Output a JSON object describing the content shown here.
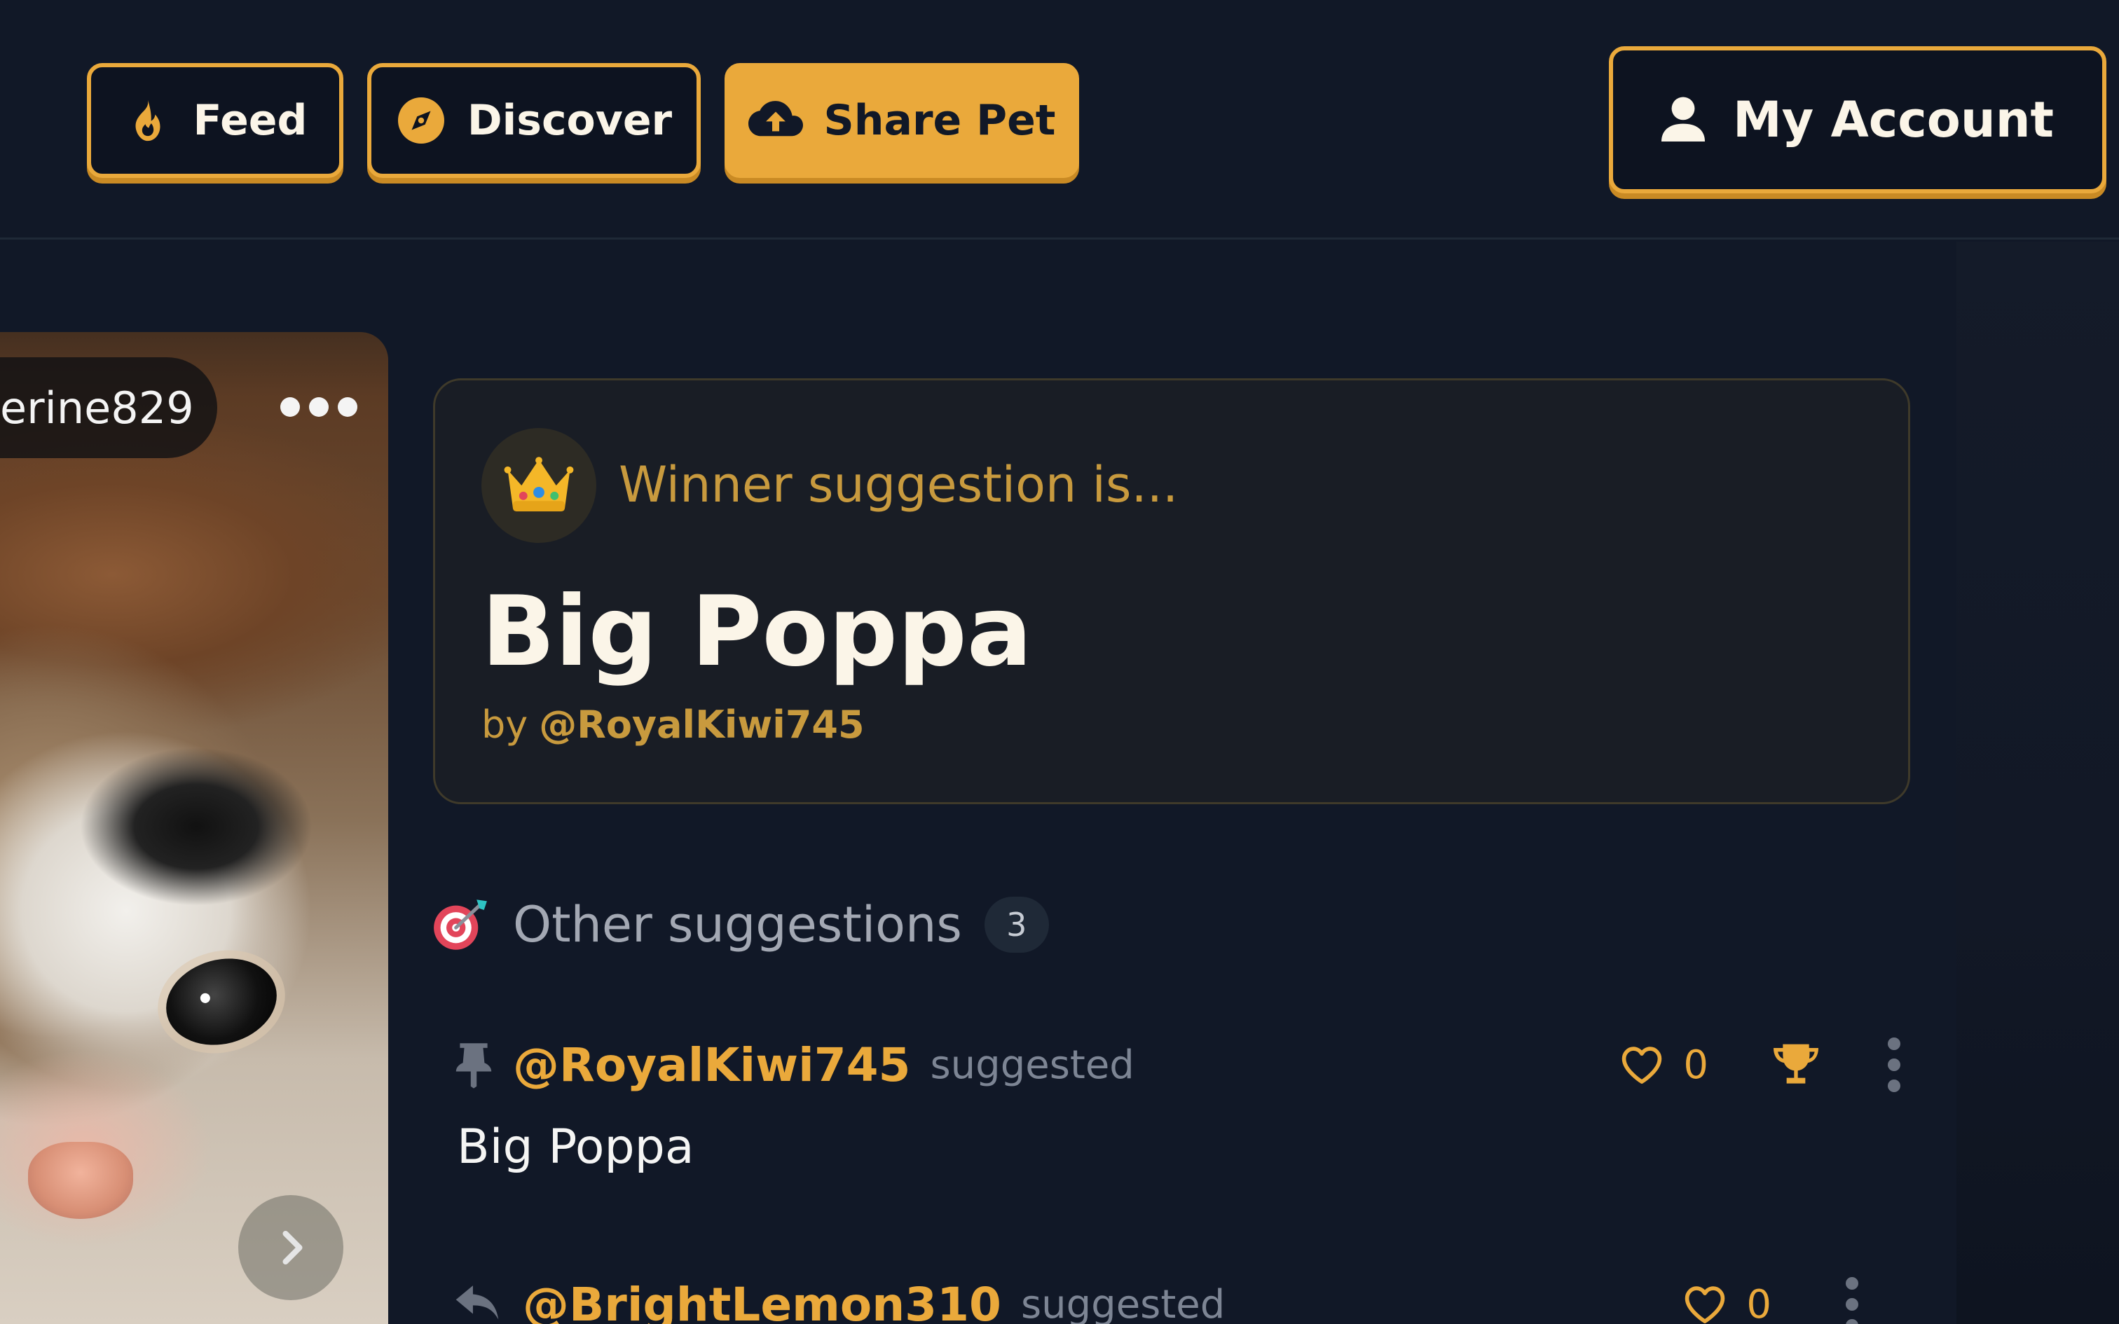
{
  "colors": {
    "accent": "#eaa93b",
    "background": "#111827",
    "card": "#191d25",
    "muted_text": "#7d8594"
  },
  "header": {
    "nav": [
      {
        "label": "Feed",
        "icon": "flame-icon"
      },
      {
        "label": "Discover",
        "icon": "compass-icon"
      },
      {
        "label": "Share Pet",
        "icon": "cloud-upload-icon"
      }
    ],
    "account_label": "My Account",
    "account_icon": "user-icon"
  },
  "post": {
    "username_partial": "erine829",
    "more_icon": "more-horizontal-icon",
    "next_icon": "chevron-right-icon"
  },
  "winner": {
    "icon": "crown-icon",
    "label": "Winner suggestion is...",
    "name": "Big Poppa",
    "by_prefix": "by",
    "by_handle": "@RoyalKiwi745"
  },
  "other": {
    "icon": "dart-target-icon",
    "title": "Other suggestions",
    "count": "3",
    "items": [
      {
        "status_icon": "pin-icon",
        "handle": "@RoyalKiwi745",
        "verb": "suggested",
        "text": "Big Poppa",
        "likes": "0",
        "is_winner": true
      },
      {
        "status_icon": "reply-icon",
        "handle": "@BrightLemon310",
        "verb": "suggested",
        "likes": "0",
        "is_winner": false
      }
    ]
  }
}
